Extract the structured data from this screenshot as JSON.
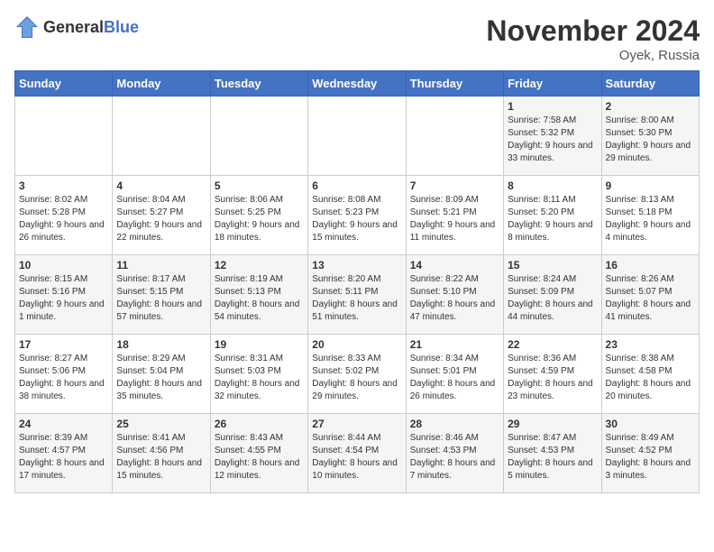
{
  "logo": {
    "general": "General",
    "blue": "Blue"
  },
  "title": "November 2024",
  "location": "Oyek, Russia",
  "days_header": [
    "Sunday",
    "Monday",
    "Tuesday",
    "Wednesday",
    "Thursday",
    "Friday",
    "Saturday"
  ],
  "weeks": [
    [
      {
        "day": "",
        "info": ""
      },
      {
        "day": "",
        "info": ""
      },
      {
        "day": "",
        "info": ""
      },
      {
        "day": "",
        "info": ""
      },
      {
        "day": "",
        "info": ""
      },
      {
        "day": "1",
        "info": "Sunrise: 7:58 AM\nSunset: 5:32 PM\nDaylight: 9 hours and 33 minutes."
      },
      {
        "day": "2",
        "info": "Sunrise: 8:00 AM\nSunset: 5:30 PM\nDaylight: 9 hours and 29 minutes."
      }
    ],
    [
      {
        "day": "3",
        "info": "Sunrise: 8:02 AM\nSunset: 5:28 PM\nDaylight: 9 hours and 26 minutes."
      },
      {
        "day": "4",
        "info": "Sunrise: 8:04 AM\nSunset: 5:27 PM\nDaylight: 9 hours and 22 minutes."
      },
      {
        "day": "5",
        "info": "Sunrise: 8:06 AM\nSunset: 5:25 PM\nDaylight: 9 hours and 18 minutes."
      },
      {
        "day": "6",
        "info": "Sunrise: 8:08 AM\nSunset: 5:23 PM\nDaylight: 9 hours and 15 minutes."
      },
      {
        "day": "7",
        "info": "Sunrise: 8:09 AM\nSunset: 5:21 PM\nDaylight: 9 hours and 11 minutes."
      },
      {
        "day": "8",
        "info": "Sunrise: 8:11 AM\nSunset: 5:20 PM\nDaylight: 9 hours and 8 minutes."
      },
      {
        "day": "9",
        "info": "Sunrise: 8:13 AM\nSunset: 5:18 PM\nDaylight: 9 hours and 4 minutes."
      }
    ],
    [
      {
        "day": "10",
        "info": "Sunrise: 8:15 AM\nSunset: 5:16 PM\nDaylight: 9 hours and 1 minute."
      },
      {
        "day": "11",
        "info": "Sunrise: 8:17 AM\nSunset: 5:15 PM\nDaylight: 8 hours and 57 minutes."
      },
      {
        "day": "12",
        "info": "Sunrise: 8:19 AM\nSunset: 5:13 PM\nDaylight: 8 hours and 54 minutes."
      },
      {
        "day": "13",
        "info": "Sunrise: 8:20 AM\nSunset: 5:11 PM\nDaylight: 8 hours and 51 minutes."
      },
      {
        "day": "14",
        "info": "Sunrise: 8:22 AM\nSunset: 5:10 PM\nDaylight: 8 hours and 47 minutes."
      },
      {
        "day": "15",
        "info": "Sunrise: 8:24 AM\nSunset: 5:09 PM\nDaylight: 8 hours and 44 minutes."
      },
      {
        "day": "16",
        "info": "Sunrise: 8:26 AM\nSunset: 5:07 PM\nDaylight: 8 hours and 41 minutes."
      }
    ],
    [
      {
        "day": "17",
        "info": "Sunrise: 8:27 AM\nSunset: 5:06 PM\nDaylight: 8 hours and 38 minutes."
      },
      {
        "day": "18",
        "info": "Sunrise: 8:29 AM\nSunset: 5:04 PM\nDaylight: 8 hours and 35 minutes."
      },
      {
        "day": "19",
        "info": "Sunrise: 8:31 AM\nSunset: 5:03 PM\nDaylight: 8 hours and 32 minutes."
      },
      {
        "day": "20",
        "info": "Sunrise: 8:33 AM\nSunset: 5:02 PM\nDaylight: 8 hours and 29 minutes."
      },
      {
        "day": "21",
        "info": "Sunrise: 8:34 AM\nSunset: 5:01 PM\nDaylight: 8 hours and 26 minutes."
      },
      {
        "day": "22",
        "info": "Sunrise: 8:36 AM\nSunset: 4:59 PM\nDaylight: 8 hours and 23 minutes."
      },
      {
        "day": "23",
        "info": "Sunrise: 8:38 AM\nSunset: 4:58 PM\nDaylight: 8 hours and 20 minutes."
      }
    ],
    [
      {
        "day": "24",
        "info": "Sunrise: 8:39 AM\nSunset: 4:57 PM\nDaylight: 8 hours and 17 minutes."
      },
      {
        "day": "25",
        "info": "Sunrise: 8:41 AM\nSunset: 4:56 PM\nDaylight: 8 hours and 15 minutes."
      },
      {
        "day": "26",
        "info": "Sunrise: 8:43 AM\nSunset: 4:55 PM\nDaylight: 8 hours and 12 minutes."
      },
      {
        "day": "27",
        "info": "Sunrise: 8:44 AM\nSunset: 4:54 PM\nDaylight: 8 hours and 10 minutes."
      },
      {
        "day": "28",
        "info": "Sunrise: 8:46 AM\nSunset: 4:53 PM\nDaylight: 8 hours and 7 minutes."
      },
      {
        "day": "29",
        "info": "Sunrise: 8:47 AM\nSunset: 4:53 PM\nDaylight: 8 hours and 5 minutes."
      },
      {
        "day": "30",
        "info": "Sunrise: 8:49 AM\nSunset: 4:52 PM\nDaylight: 8 hours and 3 minutes."
      }
    ]
  ]
}
